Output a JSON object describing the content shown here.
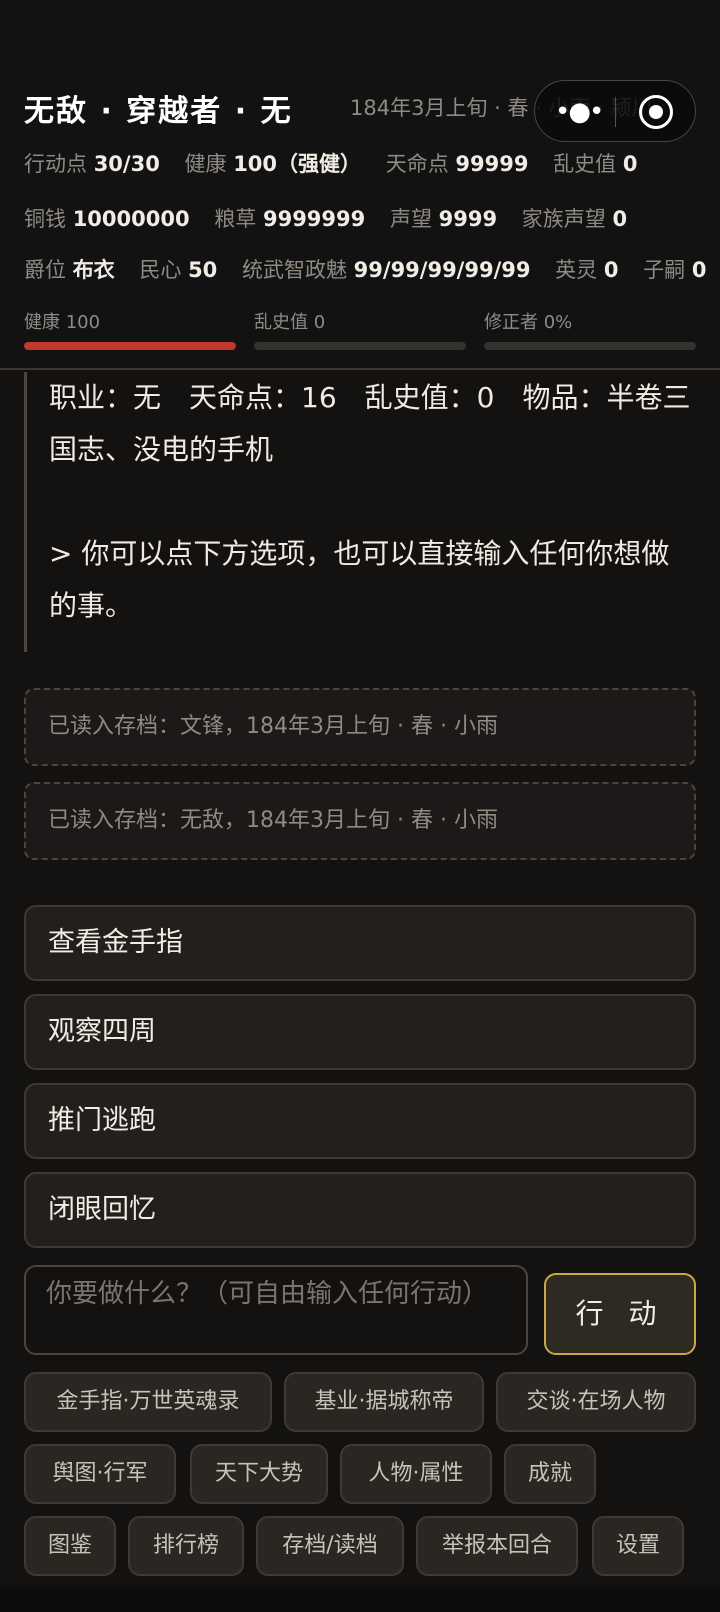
{
  "header": {
    "title": "无敌 · 穿越者 · 无",
    "date": "184年3月上旬 · 春 · 小雨 · 颍川",
    "stats_row1": [
      {
        "label": "行动点",
        "value": "30/30"
      },
      {
        "label": "健康",
        "value": "100（强健）"
      },
      {
        "label": "天命点",
        "value": "99999"
      },
      {
        "label": "乱史值",
        "value": "0"
      }
    ],
    "stats_row2": [
      {
        "label": "铜钱",
        "value": "10000000"
      },
      {
        "label": "粮草",
        "value": "9999999"
      },
      {
        "label": "声望",
        "value": "9999"
      },
      {
        "label": "家族声望",
        "value": "0"
      }
    ],
    "stats_row3": [
      {
        "label": "爵位",
        "value": "布衣"
      },
      {
        "label": "民心",
        "value": "50"
      },
      {
        "label": "统武智政魅",
        "value": "99/99/99/99/99"
      },
      {
        "label": "英灵",
        "value": "0"
      },
      {
        "label": "子嗣",
        "value": "0"
      }
    ],
    "bars": [
      {
        "label": "健康 100",
        "fraction": 1.0,
        "color": "#c0392b"
      },
      {
        "label": "乱史值 0",
        "fraction": 0.0,
        "color": "#c0392b"
      },
      {
        "label": "修正者 0%",
        "fraction": 0.0,
        "color": "#c0392b"
      }
    ]
  },
  "story": {
    "line1": "职业：无　天命点：16　乱史值：0　物品：半卷三国志、没电的手机",
    "line2": "> 你可以点下方选项，也可以直接输入任何你想做的事。"
  },
  "notices": [
    "已读入存档：文锋，184年3月上旬 · 春 · 小雨",
    "已读入存档：无敌，184年3月上旬 · 春 · 小雨"
  ],
  "options": [
    "查看金手指",
    "观察四周",
    "推门逃跑",
    "闭眼回忆"
  ],
  "input": {
    "placeholder": "你要做什么？（可自由输入任何行动）",
    "action_label": "行 动"
  },
  "chips": [
    "金手指·万世英魂录",
    "基业·据城称帝",
    "交谈·在场人物",
    "舆图·行军",
    "天下大势",
    "人物·属性",
    "成就",
    "图鉴",
    "排行榜",
    "存档/读档",
    "举报本回合",
    "设置"
  ],
  "capsule": {
    "menu_icon": "more-dots-icon",
    "close_icon": "target-icon"
  }
}
